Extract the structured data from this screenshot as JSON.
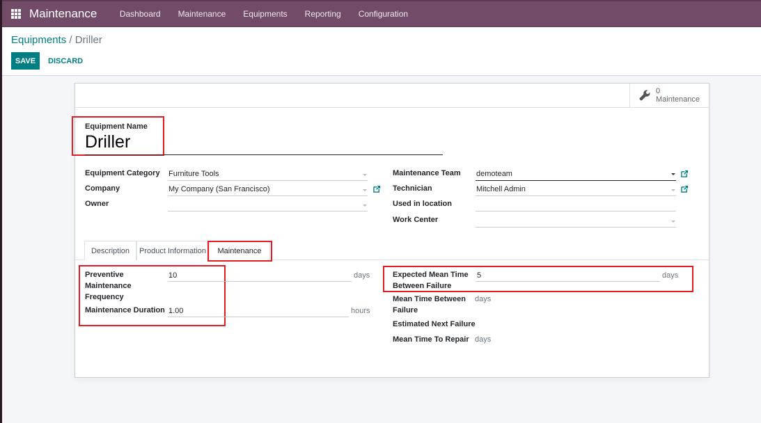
{
  "navbar": {
    "brand": "Maintenance",
    "menu": [
      "Dashboard",
      "Maintenance",
      "Equipments",
      "Reporting",
      "Configuration"
    ]
  },
  "breadcrumb": {
    "parent": "Equipments",
    "separator": "/",
    "current": "Driller"
  },
  "actions": {
    "save": "SAVE",
    "discard": "DISCARD"
  },
  "smart_button": {
    "icon": "wrench-icon",
    "value": "0",
    "label": "Maintenance"
  },
  "form": {
    "name_label": "Equipment Name",
    "name_value": "Driller",
    "left_fields": [
      {
        "label": "Equipment Category",
        "value": "Furniture Tools"
      },
      {
        "label": "Company",
        "value": "My Company (San Francisco)"
      },
      {
        "label": "Owner",
        "value": ""
      }
    ],
    "right_fields": [
      {
        "label": "Maintenance Team",
        "value": "demoteam"
      },
      {
        "label": "Technician",
        "value": "Mitchell Admin"
      },
      {
        "label": "Used in location",
        "value": ""
      },
      {
        "label": "Work Center",
        "value": ""
      }
    ]
  },
  "tabs": [
    "Description",
    "Product Information",
    "Maintenance"
  ],
  "active_tab": "Maintenance",
  "maintenance_tab": {
    "left": [
      {
        "label": "Preventive Maintenance Frequency",
        "value": "10",
        "unit": "days"
      },
      {
        "label": "Maintenance Duration",
        "value": "1.00",
        "unit": "hours"
      }
    ],
    "right": [
      {
        "label": "Expected Mean Time Between Failure",
        "value": "5",
        "unit": "days"
      },
      {
        "label": "Mean Time Between Failure",
        "value": "",
        "unit": "days"
      },
      {
        "label": "Estimated Next Failure",
        "value": "",
        "unit": ""
      },
      {
        "label": "Mean Time To Repair",
        "value": "",
        "unit": "days"
      }
    ]
  },
  "colors": {
    "brand": "#714b67",
    "primary": "#017e84",
    "highlight": "#e31b23"
  }
}
